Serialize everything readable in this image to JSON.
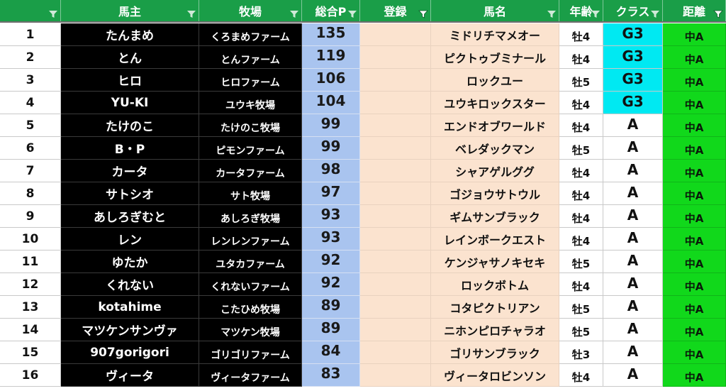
{
  "header": {
    "columns": [
      {
        "key": "no",
        "label": ""
      },
      {
        "key": "owner",
        "label": "馬主"
      },
      {
        "key": "farm",
        "label": "牧場"
      },
      {
        "key": "points",
        "label": "総合P"
      },
      {
        "key": "registered",
        "label": "登録"
      },
      {
        "key": "horse",
        "label": "馬名"
      },
      {
        "key": "age",
        "label": "年齢"
      },
      {
        "key": "class",
        "label": "クラス"
      },
      {
        "key": "distance",
        "label": "距離"
      }
    ]
  },
  "colors": {
    "header_bg": "#1a9e48",
    "owner_bg": "#000000",
    "points_bg": "#a9c4ef",
    "horse_bg": "#fbe3cf",
    "class_g3_bg": "#00e9f2",
    "distance_bg": "#11d81b"
  },
  "rows": [
    {
      "no": "1",
      "owner": "たんまめ",
      "farm": "くろまめファーム",
      "points": "135",
      "registered": "",
      "horse": "ミドリチマメオー",
      "age": "牡4",
      "class": "G3",
      "distance": "中A"
    },
    {
      "no": "2",
      "owner": "とん",
      "farm": "とんファーム",
      "points": "119",
      "registered": "",
      "horse": "ピクトゥブミナール",
      "age": "牡4",
      "class": "G3",
      "distance": "中A"
    },
    {
      "no": "3",
      "owner": "ヒロ",
      "farm": "ヒロファーム",
      "points": "106",
      "registered": "",
      "horse": "ロックユー",
      "age": "牡5",
      "class": "G3",
      "distance": "中A"
    },
    {
      "no": "4",
      "owner": "YU-KI",
      "farm": "ユウキ牧場",
      "points": "104",
      "registered": "",
      "horse": "ユウキロックスター",
      "age": "牡4",
      "class": "G3",
      "distance": "中A"
    },
    {
      "no": "5",
      "owner": "たけのこ",
      "farm": "たけのこ牧場",
      "points": "99",
      "registered": "",
      "horse": "エンドオブワールド",
      "age": "牡4",
      "class": "A",
      "distance": "中A"
    },
    {
      "no": "6",
      "owner": "B・P",
      "farm": "ピモンファーム",
      "points": "99",
      "registered": "",
      "horse": "ベレダックマン",
      "age": "牡5",
      "class": "A",
      "distance": "中A"
    },
    {
      "no": "7",
      "owner": "カータ",
      "farm": "カータファーム",
      "points": "98",
      "registered": "",
      "horse": "シャアゲルググ",
      "age": "牡4",
      "class": "A",
      "distance": "中A"
    },
    {
      "no": "8",
      "owner": "サトシオ",
      "farm": "サト牧場",
      "points": "97",
      "registered": "",
      "horse": "ゴジョウサトウル",
      "age": "牡4",
      "class": "A",
      "distance": "中A"
    },
    {
      "no": "9",
      "owner": "あしろぎむと",
      "farm": "あしろぎ牧場",
      "points": "93",
      "registered": "",
      "horse": "ギムサンブラック",
      "age": "牡4",
      "class": "A",
      "distance": "中A"
    },
    {
      "no": "10",
      "owner": "レン",
      "farm": "レンレンファーム",
      "points": "93",
      "registered": "",
      "horse": "レインボークエスト",
      "age": "牡4",
      "class": "A",
      "distance": "中A"
    },
    {
      "no": "11",
      "owner": "ゆたか",
      "farm": "ユタカファーム",
      "points": "92",
      "registered": "",
      "horse": "ケンジャサノキセキ",
      "age": "牡5",
      "class": "A",
      "distance": "中A"
    },
    {
      "no": "12",
      "owner": "くれない",
      "farm": "くれないファーム",
      "points": "92",
      "registered": "",
      "horse": "ロックボトム",
      "age": "牡4",
      "class": "A",
      "distance": "中A"
    },
    {
      "no": "13",
      "owner": "kotahime",
      "farm": "こたひめ牧場",
      "points": "89",
      "registered": "",
      "horse": "コタピクトリアン",
      "age": "牡5",
      "class": "A",
      "distance": "中A"
    },
    {
      "no": "14",
      "owner": "マツケンサンヴァ",
      "farm": "マツケン牧場",
      "points": "89",
      "registered": "",
      "horse": "ニホンピロチャラオ",
      "age": "牡5",
      "class": "A",
      "distance": "中A"
    },
    {
      "no": "15",
      "owner": "907gorigori",
      "farm": "ゴリゴリファーム",
      "points": "84",
      "registered": "",
      "horse": "ゴリサンブラック",
      "age": "牡3",
      "class": "A",
      "distance": "中A"
    },
    {
      "no": "16",
      "owner": "ヴィータ",
      "farm": "ヴィータファーム",
      "points": "83",
      "registered": "",
      "horse": "ヴィータロビンソン",
      "age": "牡4",
      "class": "A",
      "distance": "中A"
    }
  ]
}
